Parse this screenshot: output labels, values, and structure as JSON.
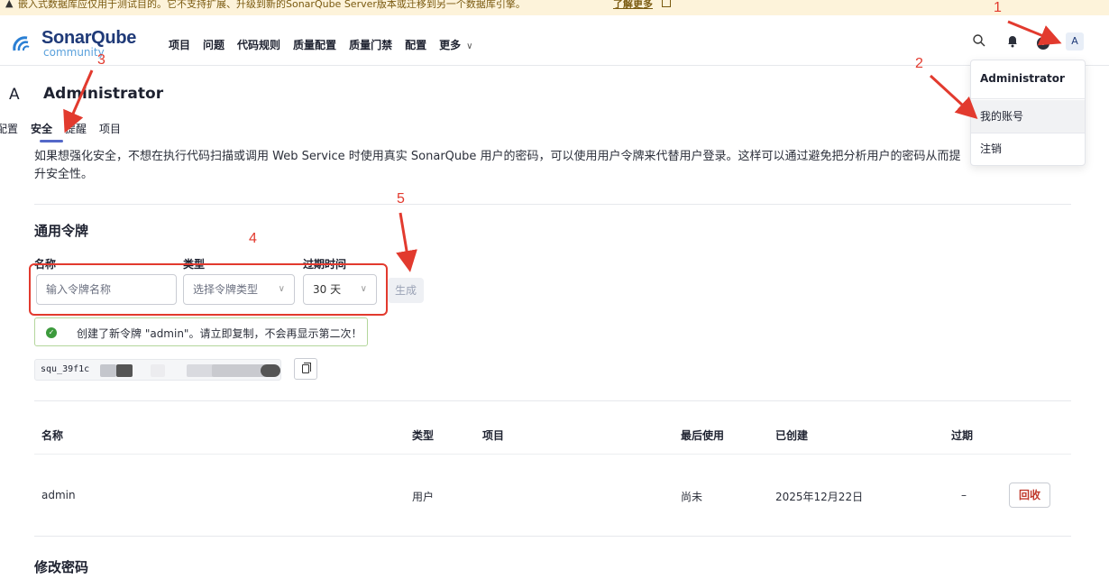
{
  "banner": {
    "text": "嵌入式数据库应仅用于测试目的。它不支持扩展、升级到新的SonarQube Server版本或迁移到另一个数据库引擎。",
    "link_label": "了解更多"
  },
  "header": {
    "logo_name": "SonarQube",
    "logo_sub": "community",
    "nav_items": [
      "项目",
      "问题",
      "代码规则",
      "质量配置",
      "质量门禁",
      "配置",
      "更多"
    ],
    "help_glyph": "?",
    "avatar_letter": "A"
  },
  "user_menu": {
    "name": "Administrator",
    "items": [
      "我的账号",
      "注销"
    ]
  },
  "page": {
    "avatar_letter": "A",
    "title": "Administrator",
    "tabs": [
      "配置",
      "安全",
      "提醒",
      "项目"
    ],
    "active_tab": "安全",
    "description": "如果想强化安全，不想在执行代码扫描或调用 Web Service 时使用真实 SonarQube 用户的密码，可以使用用户令牌来代替用户登录。这样可以通过避免把分析用户的密码从而提升安全性。"
  },
  "tokens": {
    "section_title": "通用令牌",
    "name_label": "名称",
    "type_label": "类型",
    "expiry_label": "过期时间",
    "name_placeholder": "输入令牌名称",
    "type_placeholder": "选择令牌类型",
    "expiry_value": "30 天",
    "generate_label": "生成",
    "success_message": "创建了新令牌 \"admin\"。请立即复制，不会再显示第二次！",
    "token_prefix": "squ_39f1c",
    "table": {
      "columns": [
        "名称",
        "类型",
        "项目",
        "最后使用",
        "已创建",
        "过期"
      ],
      "rows": [
        {
          "name": "admin",
          "type": "用户",
          "project": "",
          "last_used": "尚未",
          "created": "2025年12月22日",
          "expires": "–"
        }
      ],
      "revoke_label": "回收"
    }
  },
  "password_section_title": "修改密码",
  "annotations": [
    "1",
    "2",
    "3",
    "4",
    "5"
  ],
  "colors": {
    "annotation_red": "#e23a2e",
    "accent": "#5468c8",
    "banner_bg": "#fdf3da",
    "danger_text": "#c0392b",
    "success_border": "#b4d69c"
  }
}
